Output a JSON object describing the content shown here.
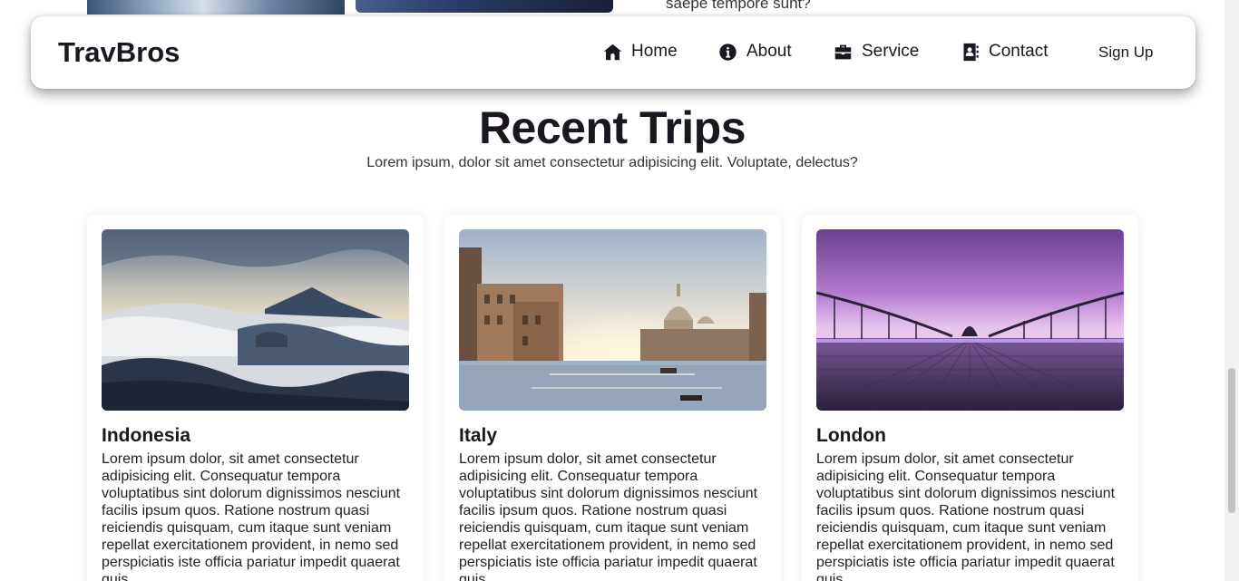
{
  "top_remnant": {
    "text": "saepe tempore sunt?"
  },
  "nav": {
    "brand": "TravBros",
    "items": [
      {
        "label": "Home",
        "icon": "home-icon"
      },
      {
        "label": "About",
        "icon": "info-icon"
      },
      {
        "label": "Service",
        "icon": "briefcase-icon"
      },
      {
        "label": "Contact",
        "icon": "address-book-icon"
      }
    ],
    "signup": "Sign Up"
  },
  "section": {
    "title": "Recent Trips",
    "subtitle": "Lorem ipsum, dolor sit amet consectetur adipisicing elit. Voluptate, delectus?"
  },
  "cards": [
    {
      "title": "Indonesia",
      "text": "Lorem ipsum dolor, sit amet consectetur adipisicing elit. Consequatur tempora voluptatibus sint dolorum dignissimos nesciunt facilis ipsum quos. Ratione nostrum quasi reiciendis quisquam, cum itaque sunt veniam repellat exercitationem provident, in nemo sed perspiciatis iste officia pariatur impedit quaerat quis."
    },
    {
      "title": "Italy",
      "text": "Lorem ipsum dolor, sit amet consectetur adipisicing elit. Consequatur tempora voluptatibus sint dolorum dignissimos nesciunt facilis ipsum quos. Ratione nostrum quasi reiciendis quisquam, cum itaque sunt veniam repellat exercitationem provident, in nemo sed perspiciatis iste officia pariatur impedit quaerat quis."
    },
    {
      "title": "London",
      "text": "Lorem ipsum dolor, sit amet consectetur adipisicing elit. Consequatur tempora voluptatibus sint dolorum dignissimos nesciunt facilis ipsum quos. Ratione nostrum quasi reiciendis quisquam, cum itaque sunt veniam repellat exercitationem provident, in nemo sed perspiciatis iste officia pariatur impedit quaerat quis."
    }
  ]
}
